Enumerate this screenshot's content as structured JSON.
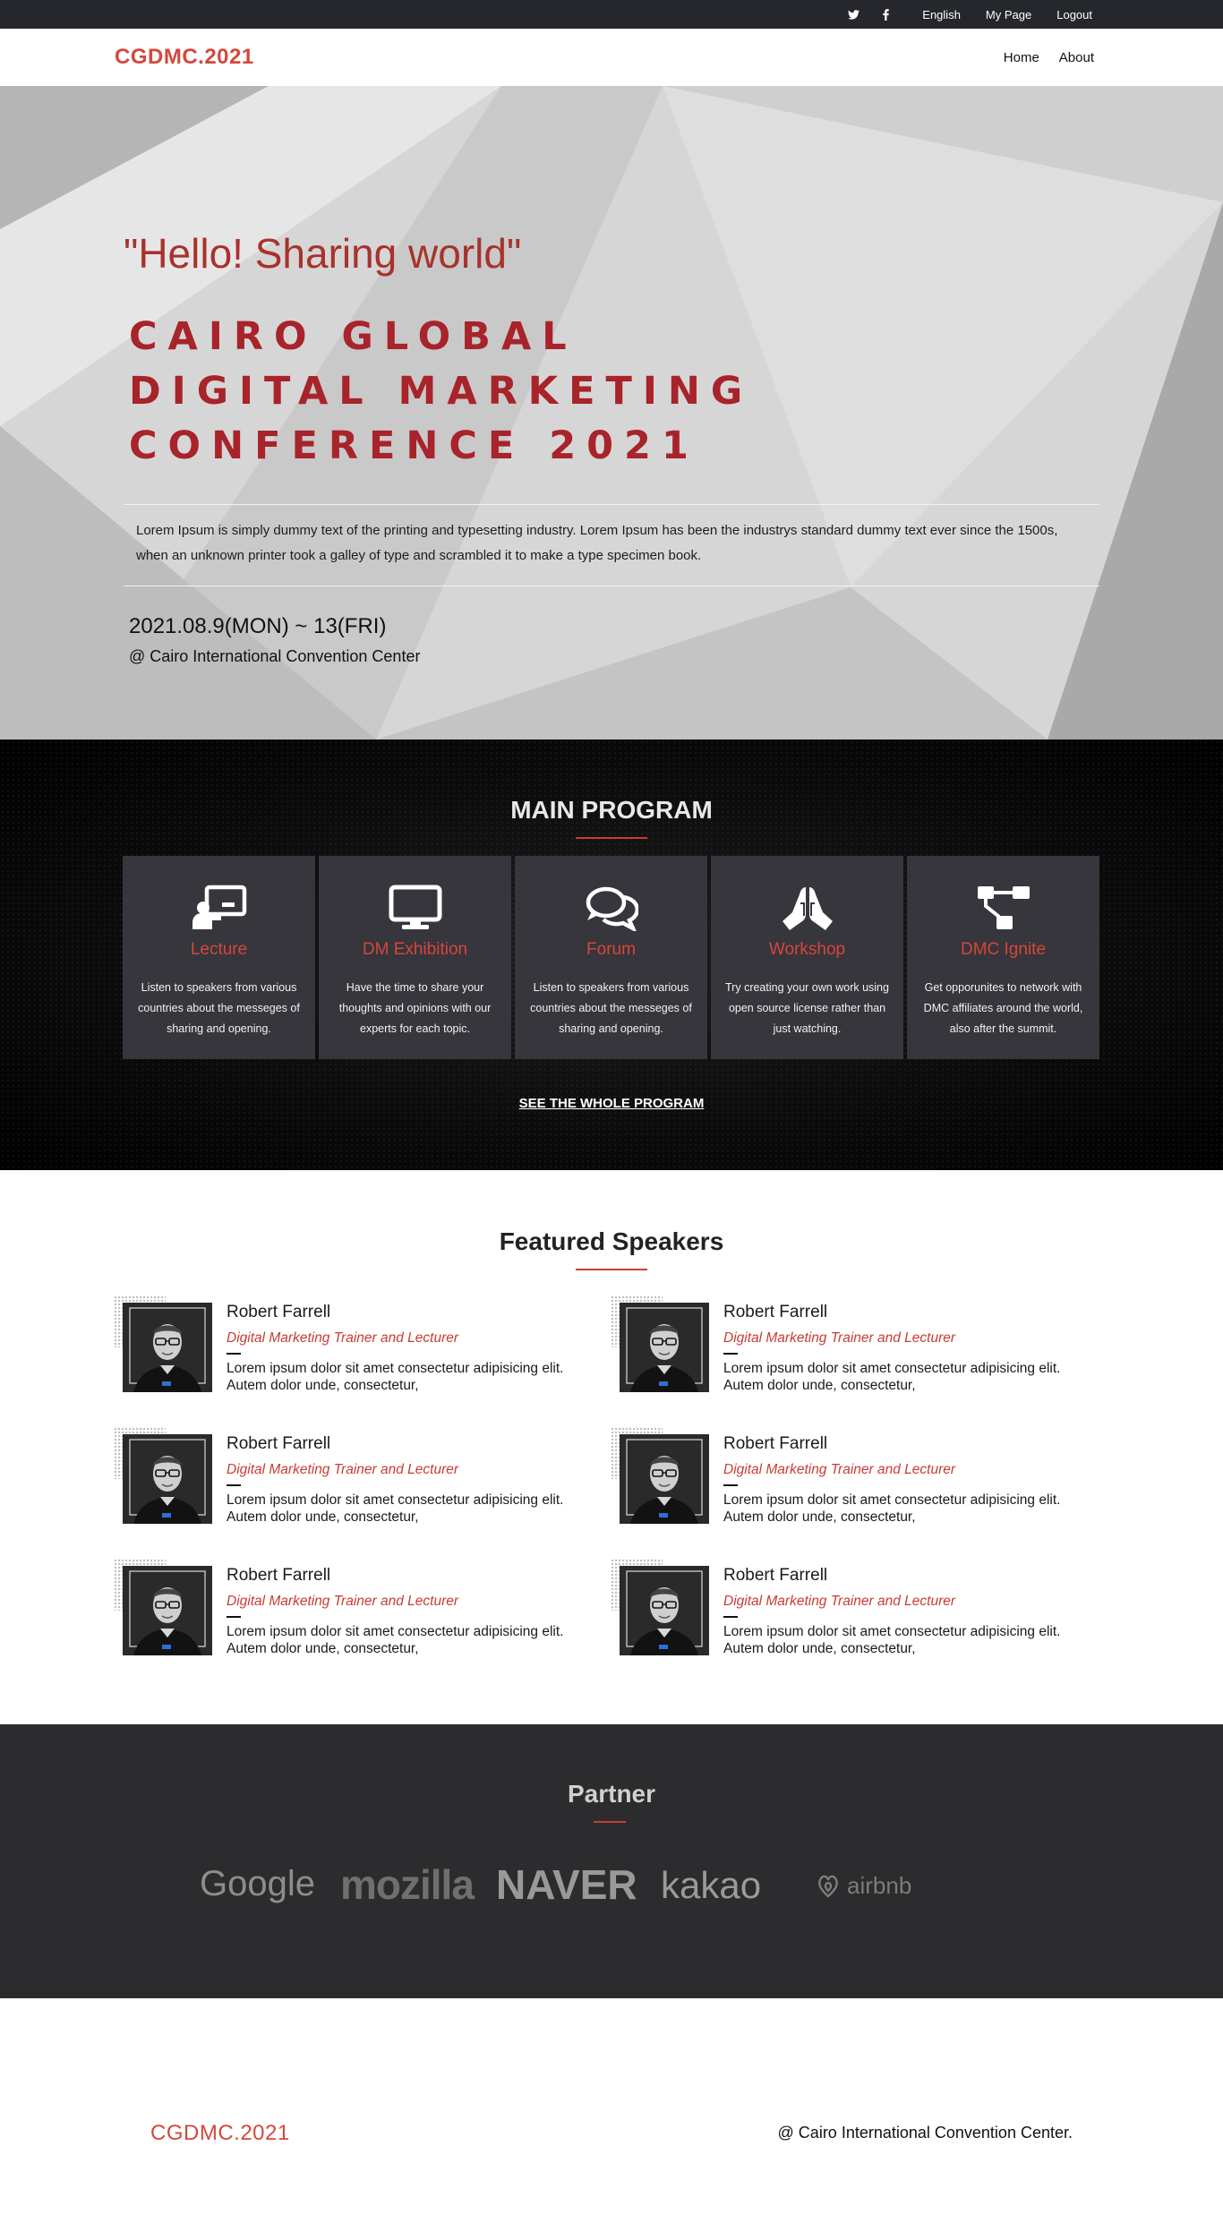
{
  "topbar": {
    "icons": [
      "twitter-icon",
      "facebook-icon"
    ],
    "links": {
      "english": "English",
      "mypage": "My Page",
      "logout": "Logout"
    }
  },
  "nav": {
    "brand": "CGDMC.2021",
    "menu": {
      "home": "Home",
      "about": "About"
    }
  },
  "hero": {
    "quote": "\"Hello! Sharing world\"",
    "title_lines": [
      "CAIRO GLOBAL",
      "DIGITAL MARKETING",
      "CONFERENCE 2021"
    ],
    "description": "Lorem Ipsum is simply dummy text of the printing and typesetting industry. Lorem Ipsum has been the industrys standard dummy text ever since the 1500s, when an unknown printer took a galley of type and scrambled it to make a type specimen book.",
    "date": "2021.08.9(MON) ~ 13(FRI)",
    "venue": "@ Cairo International Convention Center"
  },
  "program": {
    "title": "MAIN PROGRAM",
    "cards": [
      {
        "icon": "lecture-icon",
        "title": "Lecture",
        "text": "Listen to speakers from various countries about the messeges of sharing and opening."
      },
      {
        "icon": "monitor-icon",
        "title": "DM Exhibition",
        "text": "Have the time to share your thoughts and opinions with our experts for each topic."
      },
      {
        "icon": "chat-bubbles-icon",
        "title": "Forum",
        "text": "Listen to speakers from various countries about the messeges of sharing and opening."
      },
      {
        "icon": "praying-hands-icon",
        "title": "Workshop",
        "text": "Try creating your own work using open source license rather than just watching."
      },
      {
        "icon": "network-icon",
        "title": "DMC Ignite",
        "text": "Get opporunites to network with DMC affiliates around the world, also after the summit."
      }
    ],
    "more_link": "SEE THE WHOLE PROGRAM"
  },
  "speakers": {
    "title": "Featured Speakers",
    "items": [
      {
        "name": "Robert Farrell",
        "role": "Digital Marketing Trainer and Lecturer",
        "bio": "Lorem ipsum dolor sit amet consectetur adipisicing elit. Autem dolor unde, consectetur,"
      },
      {
        "name": "Robert Farrell",
        "role": "Digital Marketing Trainer and Lecturer",
        "bio": "Lorem ipsum dolor sit amet consectetur adipisicing elit. Autem dolor unde, consectetur,"
      },
      {
        "name": "Robert Farrell",
        "role": "Digital Marketing Trainer and Lecturer",
        "bio": "Lorem ipsum dolor sit amet consectetur adipisicing elit. Autem dolor unde, consectetur,"
      },
      {
        "name": "Robert Farrell",
        "role": "Digital Marketing Trainer and Lecturer",
        "bio": "Lorem ipsum dolor sit amet consectetur adipisicing elit. Autem dolor unde, consectetur,"
      },
      {
        "name": "Robert Farrell",
        "role": "Digital Marketing Trainer and Lecturer",
        "bio": "Lorem ipsum dolor sit amet consectetur adipisicing elit. Autem dolor unde, consectetur,"
      },
      {
        "name": "Robert Farrell",
        "role": "Digital Marketing Trainer and Lecturer",
        "bio": "Lorem ipsum dolor sit amet consectetur adipisicing elit. Autem dolor unde, consectetur,"
      }
    ]
  },
  "partner": {
    "title": "Partner",
    "logos": [
      "Google",
      "mozilla",
      "NAVER",
      "kakao",
      "airbnb"
    ]
  },
  "footer": {
    "brand": "CGDMC.2021",
    "address": "@ Cairo International Convention Center."
  },
  "colors": {
    "accent": "#d2493c",
    "dark": "#25272c",
    "card": "#36363c"
  }
}
